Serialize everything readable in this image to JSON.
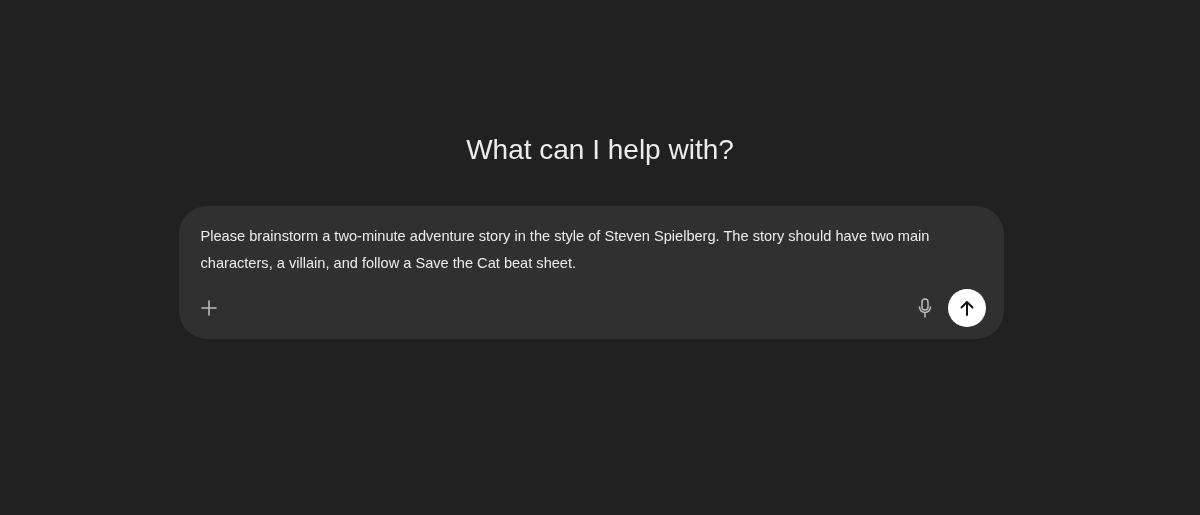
{
  "heading": "What can I help with?",
  "composer": {
    "value": "Please brainstorm a two-minute adventure story in the style of Steven Spielberg. The story should have two main characters, a villain, and follow a Save the Cat beat sheet."
  }
}
